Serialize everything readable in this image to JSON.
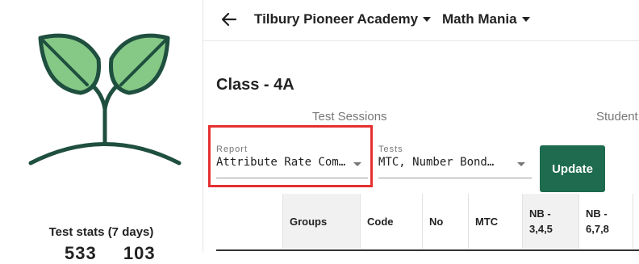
{
  "sidebar": {
    "stats_title": "Test stats (7 days)",
    "stats_values": [
      "533",
      "103"
    ]
  },
  "header": {
    "school": "Tilbury Pioneer Academy",
    "app": "Math Mania"
  },
  "page": {
    "class_title": "Class - 4A"
  },
  "tabs": [
    "Test Sessions",
    "Student"
  ],
  "filters": {
    "report_label": "Report",
    "report_value": "Attribute Rate Com…",
    "tests_label": "Tests",
    "tests_value": "MTC, Number Bond…",
    "update_label": "Update"
  },
  "table": {
    "headers": [
      "Groups",
      "Code",
      "No",
      "MTC",
      "NB -\n3,4,5",
      "NB -\n6,7,8"
    ]
  },
  "colors": {
    "brand_green": "#1e6b4f",
    "highlight_red": "#e53030",
    "leaf_green": "#86c987"
  }
}
